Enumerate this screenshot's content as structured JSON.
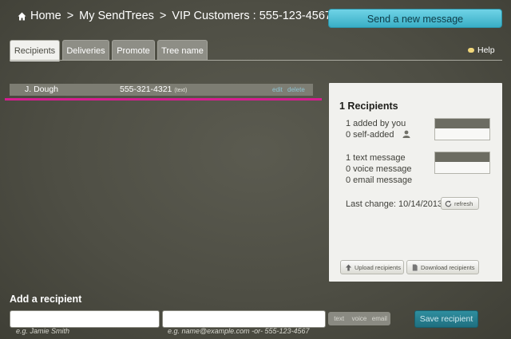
{
  "breadcrumb": {
    "items": [
      "Home",
      "My SendTrees",
      "VIP Customers : 555-123-4567"
    ],
    "separator": ">"
  },
  "header": {
    "send_button_label": "Send a new message"
  },
  "tabs": [
    {
      "label": "Recipients",
      "active": true
    },
    {
      "label": "Deliveries",
      "active": false
    },
    {
      "label": "Promote",
      "active": false
    },
    {
      "label": "Tree name",
      "active": false
    }
  ],
  "help_label": "Help",
  "recipients": [
    {
      "name": "J. Dough",
      "phone": "555-321-4321",
      "type": "(text)",
      "edit_label": "edit",
      "delete_label": "delete"
    }
  ],
  "summary": {
    "title": "1 Recipients",
    "added_by_you": "1 added by you",
    "self_added": "0 self-added",
    "added_fraction": 1.0,
    "text_message": "1 text message",
    "voice_message": "0 voice message",
    "email_message": "0 email message",
    "text_fraction": 1.0,
    "last_change": "Last change: 10/14/2013",
    "refresh_label": "refresh",
    "upload_label": "Upload recipients",
    "download_label": "Download recipients"
  },
  "add_recipient": {
    "title": "Add a recipient",
    "name_value": "",
    "contact_value": "",
    "name_hint": "e.g. Jamie Smith",
    "contact_hint": "e.g. name@example.com -or- 555-123-4567",
    "type_options": [
      "text",
      "voice",
      "email"
    ],
    "save_label": "Save recipient"
  },
  "colors": {
    "background": "#4e4e44",
    "accent": "#39aec6",
    "highlight_line": "#d51e8f",
    "panel": "#f1f1ee"
  }
}
